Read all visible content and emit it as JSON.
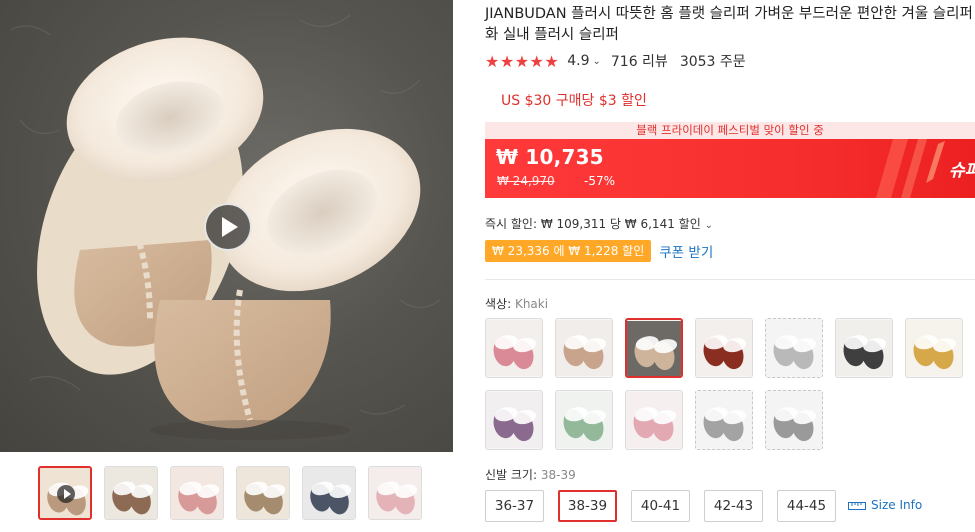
{
  "gallery": {
    "thumbnails": [
      {
        "kind": "video",
        "colors": [
          "#efe3d4",
          "#b99a7e"
        ]
      },
      {
        "kind": "image",
        "colors": [
          "#ece7df",
          "#8d6a54"
        ]
      },
      {
        "kind": "image",
        "colors": [
          "#f3e7e1",
          "#d89999"
        ]
      },
      {
        "kind": "image",
        "colors": [
          "#eee6da",
          "#a58c6e"
        ]
      },
      {
        "kind": "image",
        "colors": [
          "#e9e9ea",
          "#4c5566"
        ]
      },
      {
        "kind": "image",
        "colors": [
          "#f5ecec",
          "#e4b3b8"
        ]
      }
    ]
  },
  "product": {
    "title": "JIANBUDAN 플러시 따뜻한 홈 플랫 슬리퍼 가벼운 부드러운 편안한 겨울 슬리퍼 화 실내 플러시 슬리퍼",
    "rating": "4.9",
    "reviews": "716 리뷰",
    "orders": "3053 주문",
    "promo_line": "US $30 구매당 $3 할인"
  },
  "price_banner": {
    "top_text": "블랙 프라이데이 페스티벌 맞이 할인 중",
    "current_price": "₩ 10,735",
    "original_price": "₩ 24,970",
    "discount_percent": "-57%",
    "side_tag": "슈퍼"
  },
  "discounts": {
    "instant_text": "즉시 할인: ₩ 109,311 당 ₩ 6,141 할인",
    "coupon_badge": "₩ 23,336 에 ₩ 1,228 할인",
    "coupon_link": "쿠폰 받기"
  },
  "color_selector": {
    "label": "색상:",
    "selected": "Khaki",
    "swatches": [
      {
        "bg": "#f3efed",
        "color": "#d98a96",
        "selected": false,
        "dashed": false
      },
      {
        "bg": "#f1edea",
        "color": "#c9a48c",
        "selected": false,
        "dashed": false
      },
      {
        "bg": "#6d6a66",
        "color": "#cdb49a",
        "selected": true,
        "dashed": false
      },
      {
        "bg": "#f2efec",
        "color": "#8a2e22",
        "selected": false,
        "dashed": false
      },
      {
        "bg": "#f4f4f4",
        "color": "#b9b9b9",
        "selected": false,
        "dashed": true
      },
      {
        "bg": "#f1efec",
        "color": "#3f3f3f",
        "selected": false,
        "dashed": false
      },
      {
        "bg": "#f6f2ec",
        "color": "#d6a84a",
        "selected": false,
        "dashed": false
      },
      {
        "bg": "#f2eff0",
        "color": "#8a6a8e",
        "selected": false,
        "dashed": false
      },
      {
        "bg": "#f0f2ef",
        "color": "#93b89a",
        "selected": false,
        "dashed": false
      },
      {
        "bg": "#f5eff0",
        "color": "#e2a9b3",
        "selected": false,
        "dashed": false
      },
      {
        "bg": "#f4f4f4",
        "color": "#a3a3a3",
        "selected": false,
        "dashed": true
      },
      {
        "bg": "#f4f4f4",
        "color": "#9a9a9a",
        "selected": false,
        "dashed": true
      }
    ]
  },
  "size_selector": {
    "label": "신발 크기:",
    "selected": "38-39",
    "options": [
      "36-37",
      "38-39",
      "40-41",
      "42-43",
      "44-45"
    ],
    "info_link": "Size Info"
  },
  "colors": {
    "accent": "#e0302d",
    "banner": "#f52c2c",
    "link": "#1a73c4",
    "coupon": "#ffa726"
  }
}
